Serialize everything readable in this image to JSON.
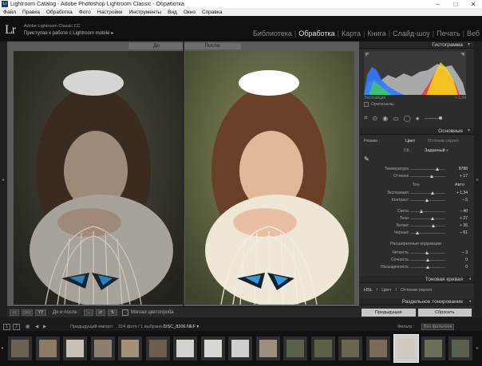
{
  "window": {
    "title": "Lightroom Catalog - Adobe Photoshop Lightroom Classic - Обработка",
    "app_icon": "Lr",
    "controls": [
      "–",
      "□",
      "✕"
    ]
  },
  "menu": [
    "Файл",
    "Правка",
    "Обработка",
    "Фото",
    "Настройки",
    "Инструменты",
    "Вид",
    "Окно",
    "Справка"
  ],
  "identity": {
    "logo": "Lr",
    "line1": "Adobe Lightroom Classic CC",
    "line2": "Приступая к работе с Lightroom mobile",
    "chevron": "▸"
  },
  "modules": {
    "items": [
      "Библиотека",
      "Обработка",
      "Карта",
      "Книга",
      "Слайд-шоу",
      "Печать",
      "Веб"
    ],
    "active_index": 1,
    "separator": "|"
  },
  "view": {
    "before_label": "До",
    "after_label": "После"
  },
  "toolbar": {
    "before_after_label": "До и после :",
    "soft_proofing_label": "Мягкая цветопроба",
    "view_mode_labels": [
      "▭",
      "▭▭",
      "YY"
    ],
    "arrow_labels": [
      "→",
      "⇄",
      "⇅"
    ]
  },
  "histogram": {
    "title": "Гистограмма",
    "exposure_label": "Экспозиция",
    "exposure_value": "+ 1,34",
    "original_label": "Оригиналы",
    "colors": {
      "blue": "#2f7bff",
      "red": "#ff2a2a",
      "yellow": "#f2e21a",
      "green": "#3ddc3d",
      "gray": "#bdbdbd"
    }
  },
  "basic": {
    "title": "Основные",
    "treatment_label": "Режим :",
    "treatment_color": "Цвет",
    "treatment_bw": "Оттенки серого",
    "profile_prefix": "ББ :",
    "profile_value": "Заданный ÷",
    "wb": [
      {
        "label": "Температура",
        "value": "8788",
        "pos": 0.78
      },
      {
        "label": "Оттенок",
        "value": "+ 17",
        "pos": 0.62
      }
    ],
    "tone_label": "Тон",
    "auto_label": "Авто",
    "tone": [
      {
        "label": "Экспозиция",
        "value": "+ 1,34",
        "pos": 0.63
      },
      {
        "label": "Контраст",
        "value": "– 5",
        "pos": 0.47
      }
    ],
    "presence_tone": [
      {
        "label": "Света",
        "value": "– 40",
        "pos": 0.32
      },
      {
        "label": "Тени",
        "value": "+ 27",
        "pos": 0.63
      },
      {
        "label": "Белые",
        "value": "+ 35",
        "pos": 0.67
      },
      {
        "label": "Черные",
        "value": "– 61",
        "pos": 0.2
      }
    ],
    "presence_label": "Расширенные коррекции",
    "presence": [
      {
        "label": "Четкость",
        "value": "– 3",
        "pos": 0.48
      },
      {
        "label": "Сочность",
        "value": "0",
        "pos": 0.5
      },
      {
        "label": "Насыщенность",
        "value": "0",
        "pos": 0.5
      }
    ]
  },
  "tone_curve": {
    "title": "Тоновая кривая"
  },
  "hsl": {
    "items": [
      "HSL",
      "Цвет",
      "Оттенки серого"
    ]
  },
  "split_toning": {
    "title": "Раздельное тонирование"
  },
  "right_buttons": {
    "previous": "Предыдущая",
    "reset": "Сбросить"
  },
  "filmstrip_bar": {
    "monitor1": "1",
    "monitor2": "2",
    "source": "Предыдущий импорт",
    "count": "224 фото / 1 выбрано",
    "filename": "/DSC_8206.NEF ▾",
    "filter_label": "Фильтр :",
    "filter_value": "Без фильтров"
  },
  "filmstrip": {
    "thumb_colors": [
      "#6d6055",
      "#8a7a66",
      "#c7c0b6",
      "#8d7f72",
      "#a38f7a",
      "#6c5f52",
      "#d4d2cf",
      "#d9d7d3",
      "#cfcfcd",
      "#9b8f7e",
      "#586049",
      "#5b5f4a",
      "#6a6452",
      "#7c6a58",
      "#cfc9c2",
      "#6b7058",
      "#5a6050"
    ],
    "selected_index": 14
  }
}
